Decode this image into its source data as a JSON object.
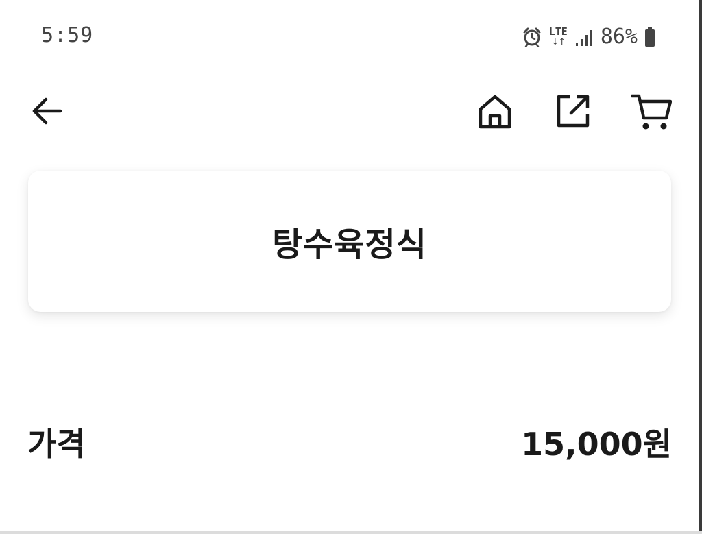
{
  "status_bar": {
    "time": "5:59",
    "network_label": "LTE",
    "network_arrows": "↓↑",
    "battery_percent": "86%",
    "icons": [
      "alarm-icon",
      "lte-icon",
      "signal-icon",
      "battery-icon"
    ]
  },
  "app_bar": {
    "icons": [
      "back-arrow-icon",
      "home-icon",
      "share-icon",
      "cart-icon"
    ]
  },
  "product": {
    "title": "탕수육정식"
  },
  "price": {
    "label": "가격",
    "value": "15,000원"
  },
  "colors": {
    "text": "#1a1a1a",
    "status_text": "#444444",
    "background": "#ffffff"
  }
}
